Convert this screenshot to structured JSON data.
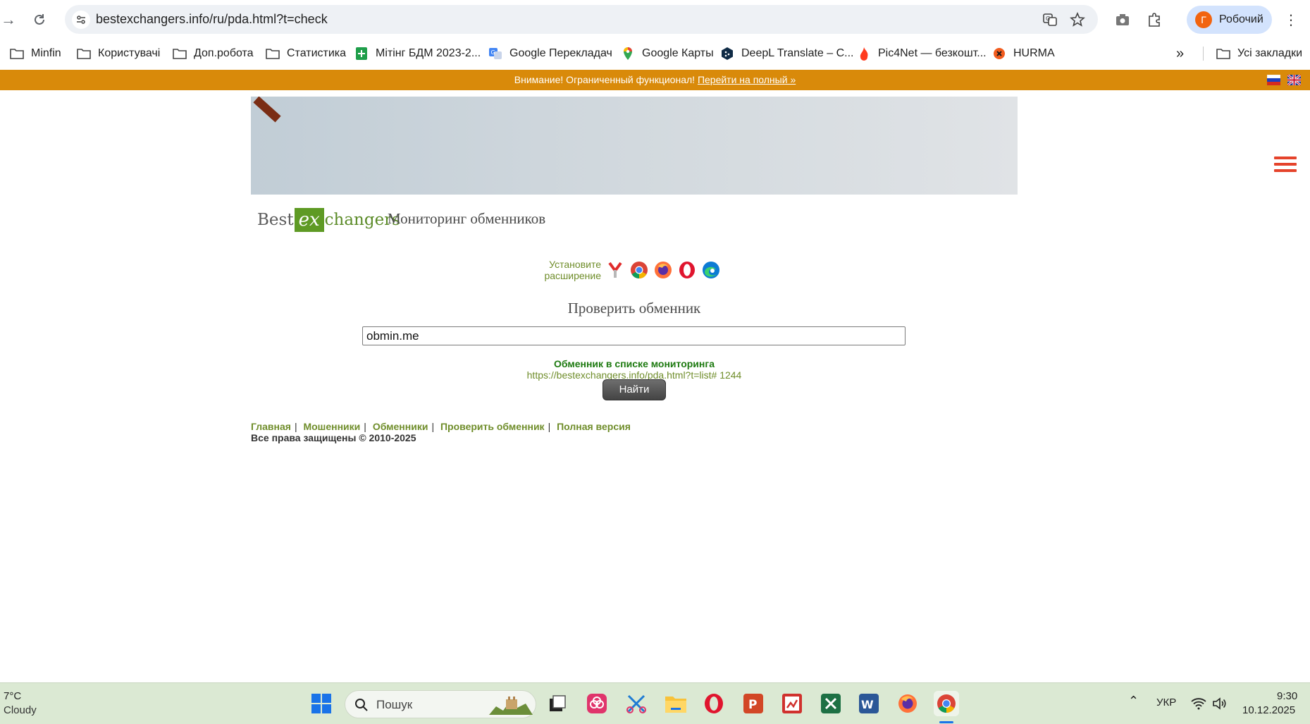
{
  "browser": {
    "url": "bestexchangers.info/ru/pda.html?t=check",
    "profile_initial": "Г",
    "profile_name": "Робочий"
  },
  "bookmarks": {
    "items": [
      {
        "label": "Minfin"
      },
      {
        "label": "Користувачі"
      },
      {
        "label": "Доп.робота"
      },
      {
        "label": "Статистика"
      },
      {
        "label": "Мітінг БДМ 2023-2..."
      },
      {
        "label": "Google Перекладач"
      },
      {
        "label": "Google Карты"
      },
      {
        "label": "DeepL Translate – С..."
      },
      {
        "label": "Pic4Net — безкошт..."
      },
      {
        "label": "HURMA"
      }
    ],
    "overflow": "»",
    "all_bookmarks": "Усі закладки"
  },
  "warning": {
    "text": "Внимание! Ограниченный функционал!",
    "link": "Перейти на полный »"
  },
  "logo": {
    "best": "Best",
    "ex": "ex",
    "changers": "changers",
    "tagline": "Мониторинг обменников"
  },
  "extension": {
    "label_line1": "Установите",
    "label_line2": "расширение"
  },
  "check": {
    "title": "Проверить обменник",
    "input_value": "obmin.me",
    "status": "Обменник в списке мониторинга",
    "result_link": "https://bestexchangers.info/pda.html?t=list# 1244",
    "button": "Найти"
  },
  "footer": {
    "links": [
      "Главная",
      "Мошенники",
      "Обменники",
      "Проверить обменник",
      "Полная версия"
    ],
    "separator": "|",
    "copyright": "Все права защищены © 2010-2025"
  },
  "taskbar": {
    "weather_temp": "7°C",
    "weather_cond": "Cloudy",
    "search_placeholder": "Пошук",
    "language": "УКР",
    "time": "9:30",
    "date": "10.12.2025"
  },
  "colors": {
    "warning_bar": "#d98a0a",
    "link_green": "#6f8d2a",
    "status_green": "#1d7a10",
    "hamburger": "#e5432b",
    "taskbar": "#dbe9d3"
  }
}
